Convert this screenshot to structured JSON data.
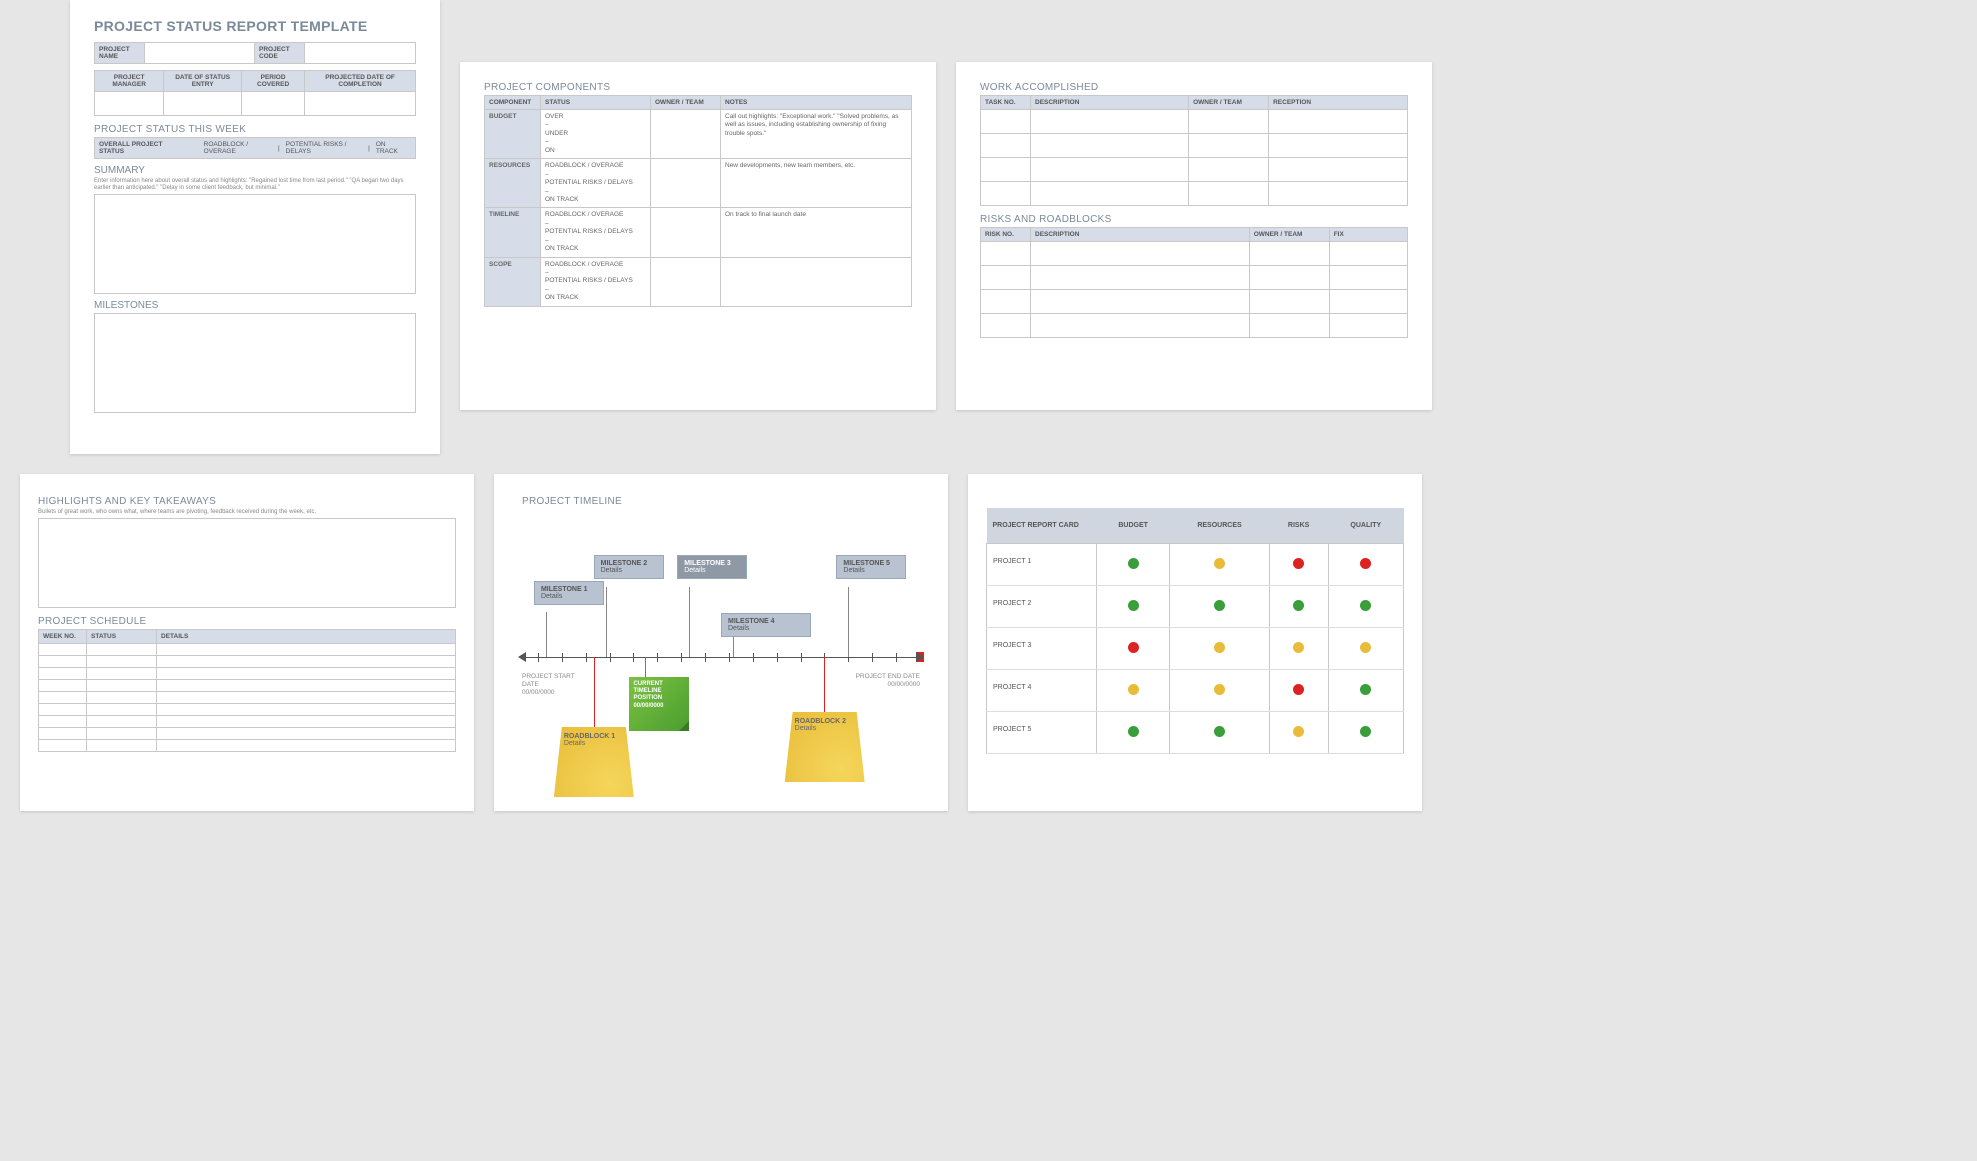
{
  "page1": {
    "title": "PROJECT STATUS REPORT TEMPLATE",
    "meta1": {
      "name_lbl": "PROJECT NAME",
      "code_lbl": "PROJECT CODE"
    },
    "meta2": {
      "mgr": "PROJECT MANAGER",
      "date": "DATE OF STATUS ENTRY",
      "period": "PERIOD COVERED",
      "proj": "PROJECTED DATE OF COMPLETION"
    },
    "status_heading": "PROJECT STATUS THIS WEEK",
    "status_lbl": "OVERALL PROJECT STATUS",
    "opt1": "ROADBLOCK / OVERAGE",
    "sep": "|",
    "opt2": "POTENTIAL RISKS / DELAYS",
    "opt3": "ON TRACK",
    "summary_h": "SUMMARY",
    "summary_hint": "Enter information here about overall status and highlights: \"Regained lost time from last period.\" \"QA began two days earlier than anticipated.\" \"Delay in some client feedback, but minimal.\"",
    "milestones_h": "MILESTONES"
  },
  "page2": {
    "title": "PROJECT COMPONENTS",
    "hdr": {
      "comp": "COMPONENT",
      "status": "STATUS",
      "owner": "OWNER / TEAM",
      "notes": "NOTES"
    },
    "rows": [
      {
        "comp": "BUDGET",
        "status": "OVER\n–\nUNDER\n–\nON",
        "notes": "Call out highlights: \"Exceptional work.\" \"Solved problems, as well as issues, including establishing ownership of fixing trouble spots.\""
      },
      {
        "comp": "RESOURCES",
        "status": "ROADBLOCK / OVERAGE\n–\nPOTENTIAL RISKS / DELAYS\n–\nON TRACK",
        "notes": "New developments, new team members, etc."
      },
      {
        "comp": "TIMELINE",
        "status": "ROADBLOCK / OVERAGE\n–\nPOTENTIAL RISKS / DELAYS\n–\nON TRACK",
        "notes": "On track to final launch date"
      },
      {
        "comp": "SCOPE",
        "status": "ROADBLOCK / OVERAGE\n–\nPOTENTIAL RISKS / DELAYS\n–\nON TRACK",
        "notes": ""
      }
    ]
  },
  "page3": {
    "t1": "WORK ACCOMPLISHED",
    "t1h": {
      "a": "TASK NO.",
      "b": "DESCRIPTION",
      "c": "OWNER / TEAM",
      "d": "RECEPTION"
    },
    "t2": "RISKS AND ROADBLOCKS",
    "t2h": {
      "a": "RISK NO.",
      "b": "DESCRIPTION",
      "c": "OWNER / TEAM",
      "d": "FIX"
    }
  },
  "page4": {
    "h1": "HIGHLIGHTS AND KEY TAKEAWAYS",
    "hint": "Bullets of great work, who owns what, where teams are pivoting, feedback received during the week, etc.",
    "h2": "PROJECT SCHEDULE",
    "sh": {
      "a": "WEEK NO.",
      "b": "STATUS",
      "c": "DETAILS"
    }
  },
  "page5": {
    "title": "PROJECT TIMELINE",
    "ms1": "MILESTONE 1",
    "ms2": "MILESTONE 2",
    "ms3": "MILESTONE 3",
    "ms4": "MILESTONE 4",
    "ms5": "MILESTONE 5",
    "det": "Details",
    "start_l": "PROJECT START DATE",
    "end_l": "PROJECT END DATE",
    "date": "00/00/0000",
    "cur1": "CURRENT",
    "cur2": "TIMELINE",
    "cur3": "POSITION",
    "rb1": "ROADBLOCK 1",
    "rb2": "ROADBLOCK 2"
  },
  "page6": {
    "hdr": {
      "a": "PROJECT REPORT CARD",
      "b": "BUDGET",
      "c": "RESOURCES",
      "d": "RISKS",
      "e": "QUALITY"
    },
    "rows": [
      {
        "name": "PROJECT 1",
        "c": [
          "g",
          "y",
          "r",
          "r"
        ]
      },
      {
        "name": "PROJECT 2",
        "c": [
          "g",
          "g",
          "g",
          "g"
        ]
      },
      {
        "name": "PROJECT 3",
        "c": [
          "r",
          "y",
          "y",
          "y"
        ]
      },
      {
        "name": "PROJECT 4",
        "c": [
          "y",
          "y",
          "r",
          "g"
        ]
      },
      {
        "name": "PROJECT 5",
        "c": [
          "g",
          "g",
          "y",
          "g"
        ]
      }
    ]
  }
}
